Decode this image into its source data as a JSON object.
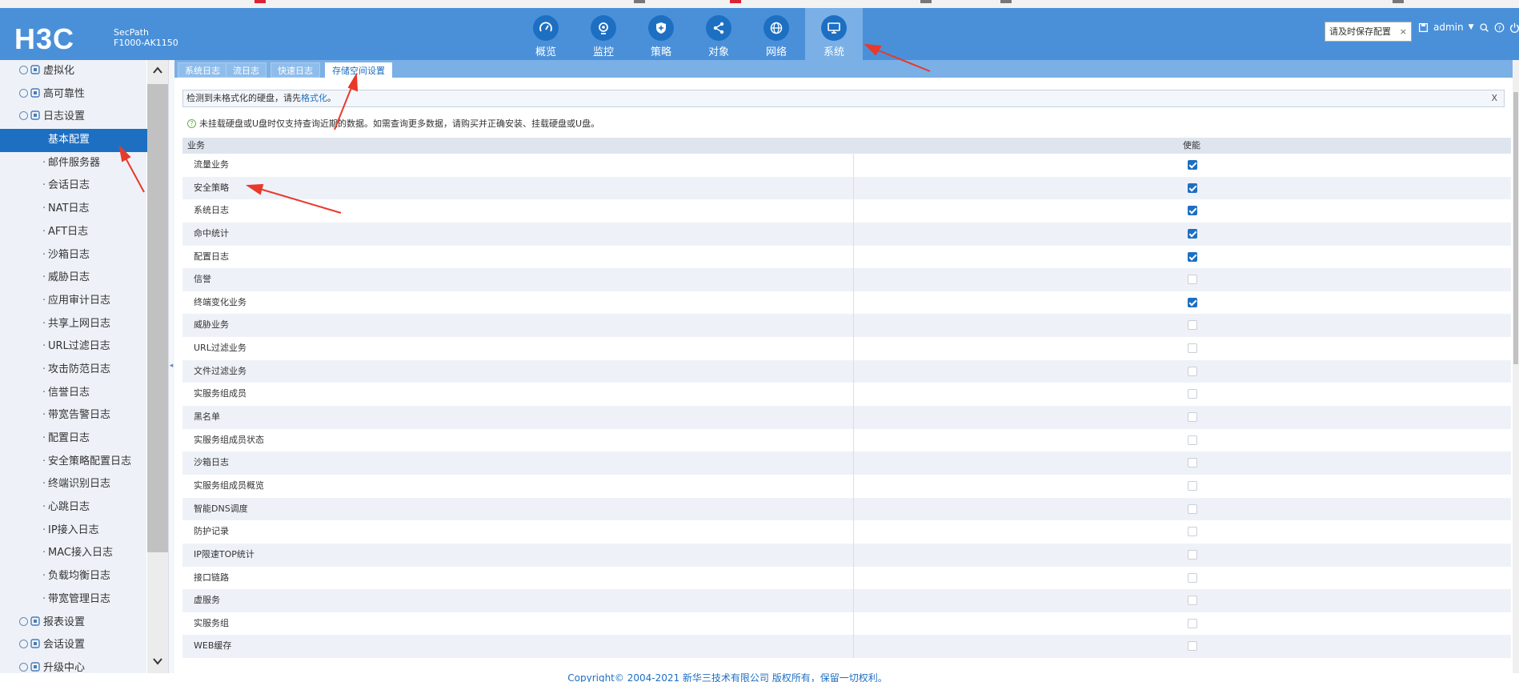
{
  "header": {
    "logo": "H3C",
    "product": "SecPath",
    "model": "F1000-AK1150",
    "nav": [
      {
        "label": "概览",
        "icon": "gauge-icon"
      },
      {
        "label": "监控",
        "icon": "camera-icon"
      },
      {
        "label": "策略",
        "icon": "shield-icon"
      },
      {
        "label": "对象",
        "icon": "share-icon"
      },
      {
        "label": "网络",
        "icon": "globe-icon"
      },
      {
        "label": "系统",
        "icon": "monitor-icon",
        "active": true
      }
    ],
    "save_tip": "请及时保存配置",
    "save_tip_close": "×",
    "user": "admin"
  },
  "sidebar": {
    "items": [
      {
        "label": "虚拟化",
        "level": 1
      },
      {
        "label": "高可靠性",
        "level": 1
      },
      {
        "label": "日志设置",
        "level": 1
      },
      {
        "label": "基本配置",
        "level": 2,
        "active": true
      },
      {
        "label": "邮件服务器",
        "level": 2
      },
      {
        "label": "会话日志",
        "level": 2
      },
      {
        "label": "NAT日志",
        "level": 2
      },
      {
        "label": "AFT日志",
        "level": 2
      },
      {
        "label": "沙箱日志",
        "level": 2
      },
      {
        "label": "威胁日志",
        "level": 2
      },
      {
        "label": "应用审计日志",
        "level": 2
      },
      {
        "label": "共享上网日志",
        "level": 2
      },
      {
        "label": "URL过滤日志",
        "level": 2
      },
      {
        "label": "攻击防范日志",
        "level": 2
      },
      {
        "label": "信誉日志",
        "level": 2
      },
      {
        "label": "带宽告警日志",
        "level": 2
      },
      {
        "label": "配置日志",
        "level": 2
      },
      {
        "label": "安全策略配置日志",
        "level": 2
      },
      {
        "label": "终端识别日志",
        "level": 2
      },
      {
        "label": "心跳日志",
        "level": 2
      },
      {
        "label": "IP接入日志",
        "level": 2
      },
      {
        "label": "MAC接入日志",
        "level": 2
      },
      {
        "label": "负载均衡日志",
        "level": 2
      },
      {
        "label": "带宽管理日志",
        "level": 2
      },
      {
        "label": "报表设置",
        "level": 1
      },
      {
        "label": "会话设置",
        "level": 1
      },
      {
        "label": "升级中心",
        "level": 1
      }
    ]
  },
  "subtabs": [
    "系统日志",
    "流日志",
    "快速日志",
    "存储空间设置"
  ],
  "notice": {
    "text": "检测到未格式化的硬盘，请先",
    "link": "格式化",
    "suffix": "。",
    "close": "X"
  },
  "hint": "未挂载硬盘或U盘时仅支持查询近期的数据。如需查询更多数据，请购买并正确安装、挂载硬盘或U盘。",
  "table": {
    "headers": [
      "业务",
      "使能"
    ],
    "rows": [
      {
        "name": "流量业务",
        "enabled": true
      },
      {
        "name": "安全策略",
        "enabled": true
      },
      {
        "name": "系统日志",
        "enabled": true
      },
      {
        "name": "命中统计",
        "enabled": true
      },
      {
        "name": "配置日志",
        "enabled": true
      },
      {
        "name": "信誉",
        "enabled": false
      },
      {
        "name": "终端变化业务",
        "enabled": true
      },
      {
        "name": "威胁业务",
        "enabled": false
      },
      {
        "name": "URL过滤业务",
        "enabled": false
      },
      {
        "name": "文件过滤业务",
        "enabled": false
      },
      {
        "name": "实服务组成员",
        "enabled": false
      },
      {
        "name": "黑名单",
        "enabled": false
      },
      {
        "name": "实服务组成员状态",
        "enabled": false
      },
      {
        "name": "沙箱日志",
        "enabled": false
      },
      {
        "name": "实服务组成员概览",
        "enabled": false
      },
      {
        "name": "智能DNS调度",
        "enabled": false
      },
      {
        "name": "防护记录",
        "enabled": false
      },
      {
        "name": "IP限速TOP统计",
        "enabled": false
      },
      {
        "name": "接口链路",
        "enabled": false
      },
      {
        "name": "虚服务",
        "enabled": false
      },
      {
        "name": "实服务组",
        "enabled": false
      },
      {
        "name": "WEB缓存",
        "enabled": false
      }
    ]
  },
  "footer": "Copyright© 2004-2021 新华三技术有限公司 版权所有，保留一切权利。",
  "colors": {
    "topbar": "#4a90d9",
    "active": "#1d6fc2",
    "annotation_arrow": "#e8392b"
  }
}
